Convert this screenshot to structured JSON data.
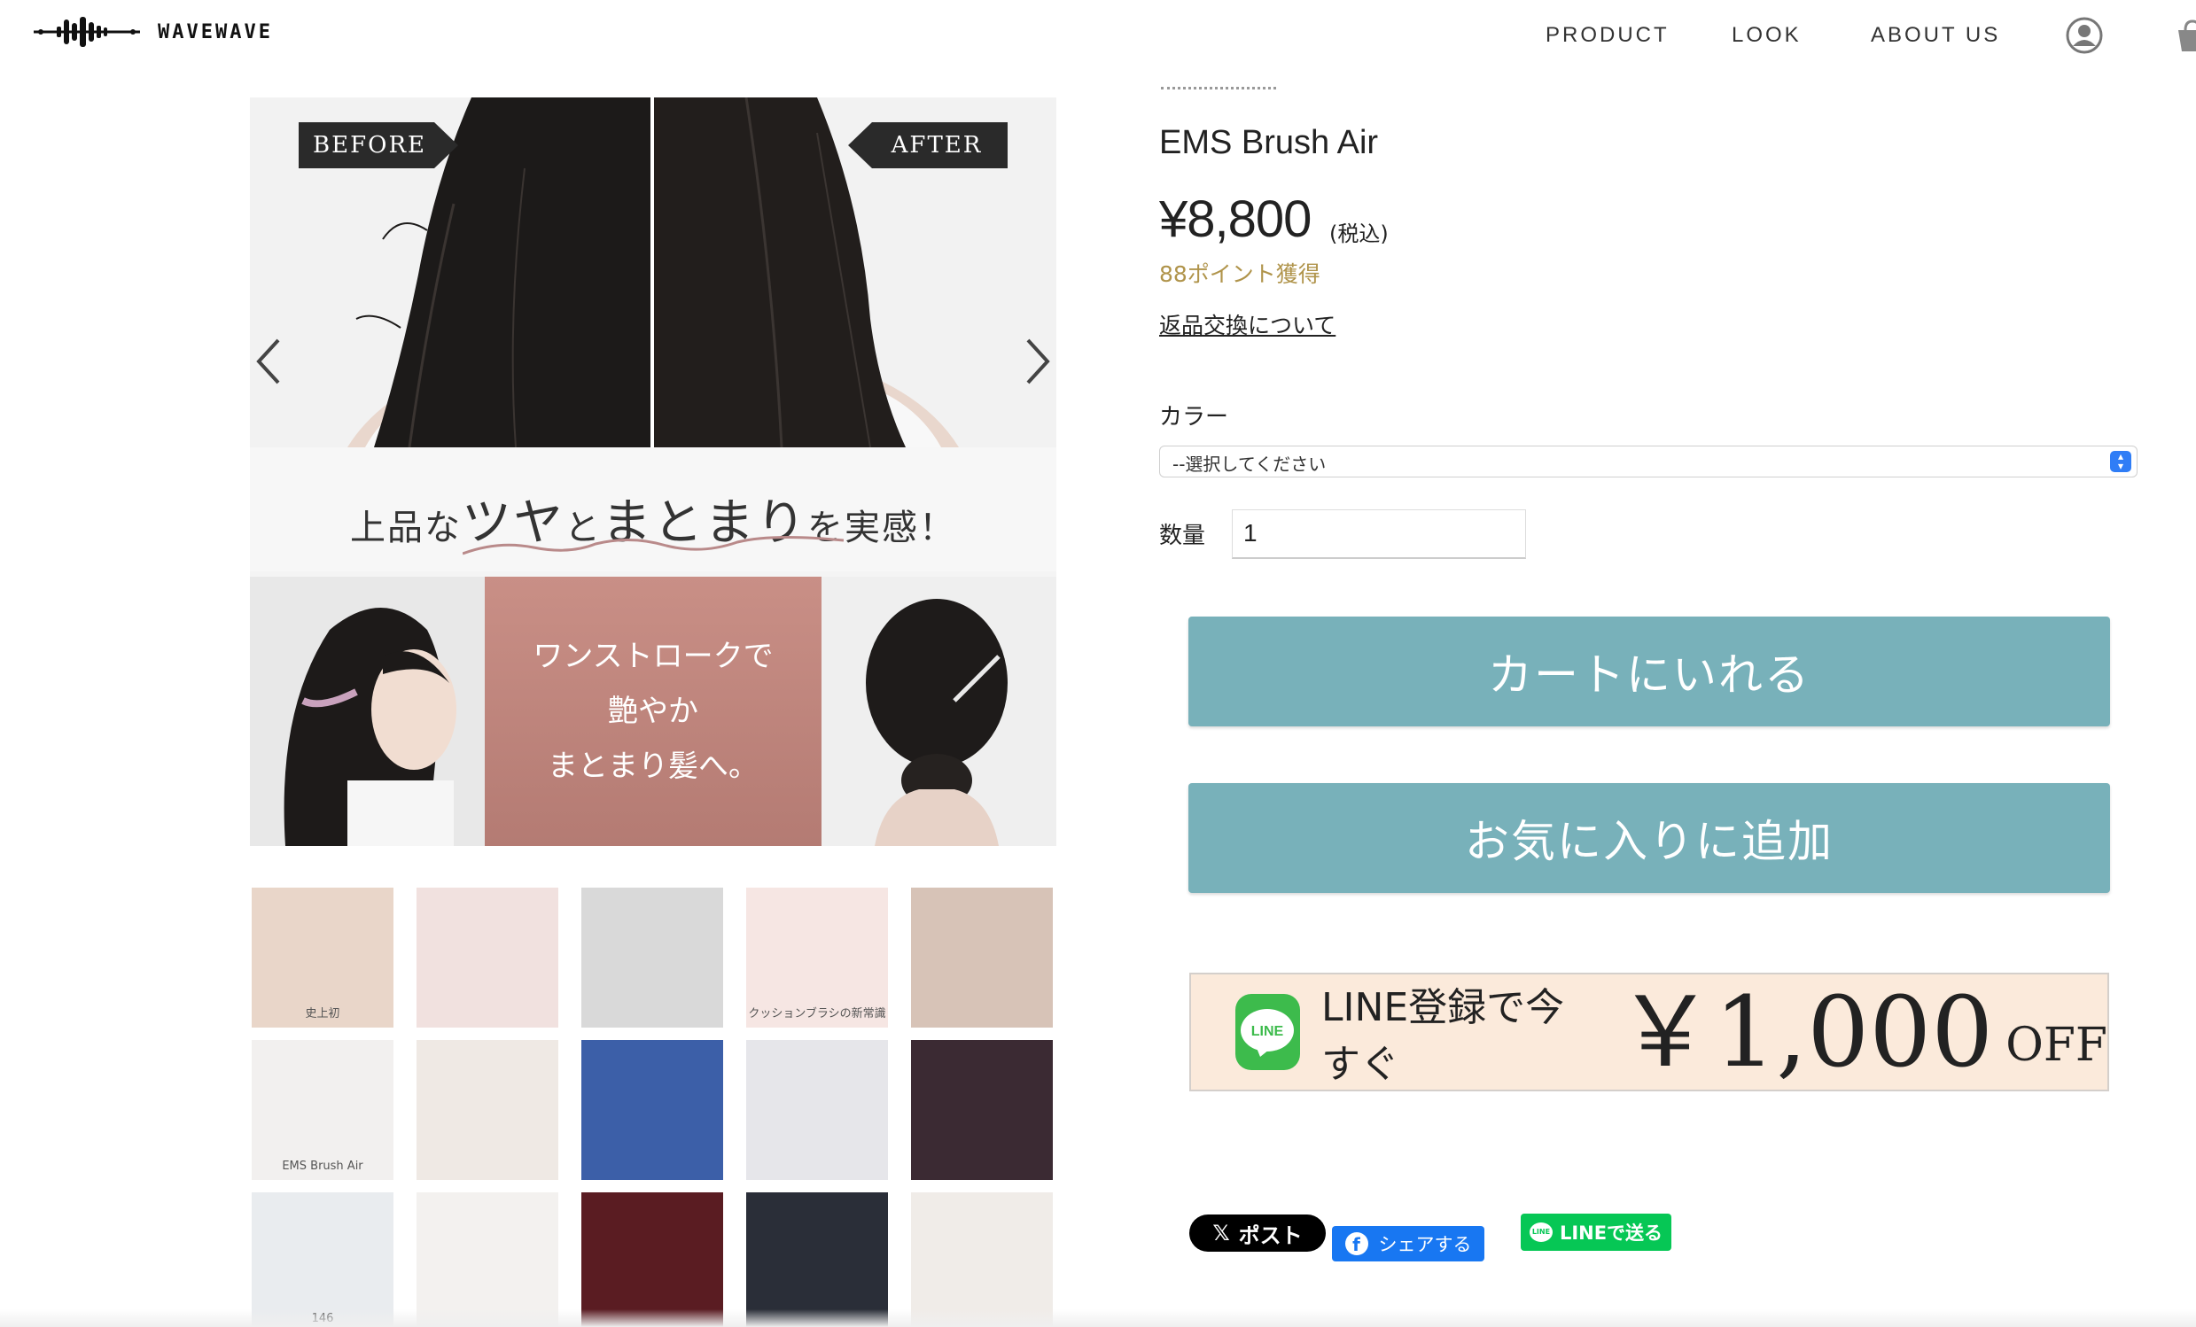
{
  "header": {
    "brand": "WAVEWAVE",
    "nav": [
      "PRODUCT",
      "LOOK",
      "ABOUT US"
    ]
  },
  "gallery": {
    "before_label": "BEFORE",
    "after_label": "AFTER",
    "tagline_parts": [
      "上品な",
      "ツヤ",
      "と",
      "まとまり",
      "を実感！"
    ],
    "stroke_lines": [
      "ワンストロークで",
      "艶やか",
      "まとまり髪へ。"
    ],
    "thumbnails": [
      {
        "caption": "史上初",
        "bg": "#e9d6c9"
      },
      {
        "caption": "",
        "bg": "#f1e1df"
      },
      {
        "caption": "",
        "bg": "#d9d9d9"
      },
      {
        "caption": "クッションブラシの新常識",
        "bg": "#f6e6e3"
      },
      {
        "caption": "",
        "bg": "#d7c3b7"
      },
      {
        "caption": "EMS Brush Air",
        "bg": "#f2f0ef"
      },
      {
        "caption": "",
        "bg": "#efe9e4"
      },
      {
        "caption": "",
        "bg": "#3c5fa8"
      },
      {
        "caption": "",
        "bg": "#e6e6ea"
      },
      {
        "caption": "",
        "bg": "#3b2a33"
      },
      {
        "caption": "146",
        "bg": "#e9ecef"
      },
      {
        "caption": "",
        "bg": "#f3f1ef"
      },
      {
        "caption": "",
        "bg": "#5a1c22"
      },
      {
        "caption": "",
        "bg": "#2a2e38"
      },
      {
        "caption": "",
        "bg": "#f0ece8"
      }
    ]
  },
  "product": {
    "name": "EMS Brush Air",
    "price": "¥8,800",
    "tax_note": "(税込)",
    "points": "88ポイント獲得",
    "returns_link": "返品交換について",
    "color_label": "カラー",
    "color_selected": "--選択してください",
    "qty_label": "数量",
    "qty_value": "1",
    "cart_button": "カートにいれる",
    "favorite_button": "お気に入りに追加"
  },
  "line_banner": {
    "logo_text": "LINE",
    "text": "LINE登録で今すぐ",
    "amount": "￥1,000",
    "off": "OFF"
  },
  "share": {
    "x_label": "ポスト",
    "facebook_label": "シェアする",
    "line_label": "LINEで送る"
  },
  "colors": {
    "button_teal": "#78b1ba",
    "points_gold": "#b0944b",
    "line_green": "#06c755"
  }
}
